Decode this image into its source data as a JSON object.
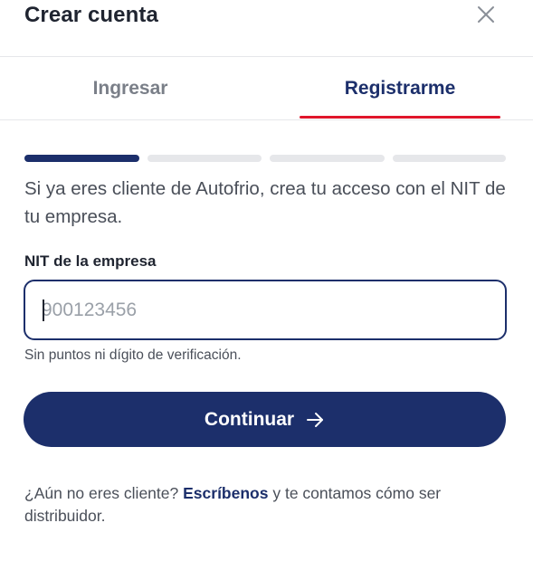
{
  "header": {
    "title": "Crear cuenta",
    "close_icon": "close-icon"
  },
  "tabs": [
    {
      "label": "Ingresar",
      "active": false
    },
    {
      "label": "Registrarme",
      "active": true
    }
  ],
  "accent_colors": {
    "primary": "#1c2f6b",
    "tab_underline": "#e0162b",
    "step_inactive": "#e6e7ea"
  },
  "progress": {
    "total_steps": 4,
    "current_step": 1
  },
  "intro_text": "Si ya eres cliente de Autofrio, crea tu acceso con el NIT de tu empresa.",
  "nit_field": {
    "label": "NIT de la empresa",
    "value": "",
    "placeholder": "900123456",
    "hint": "Sin puntos ni dígito de verificación."
  },
  "continue_button": {
    "label": "Continuar",
    "icon": "arrow-right-icon"
  },
  "footer": {
    "prefix": "¿Aún no eres cliente?",
    "link_label": "Escríbenos",
    "suffix": "y te contamos cómo ser distribuidor."
  }
}
